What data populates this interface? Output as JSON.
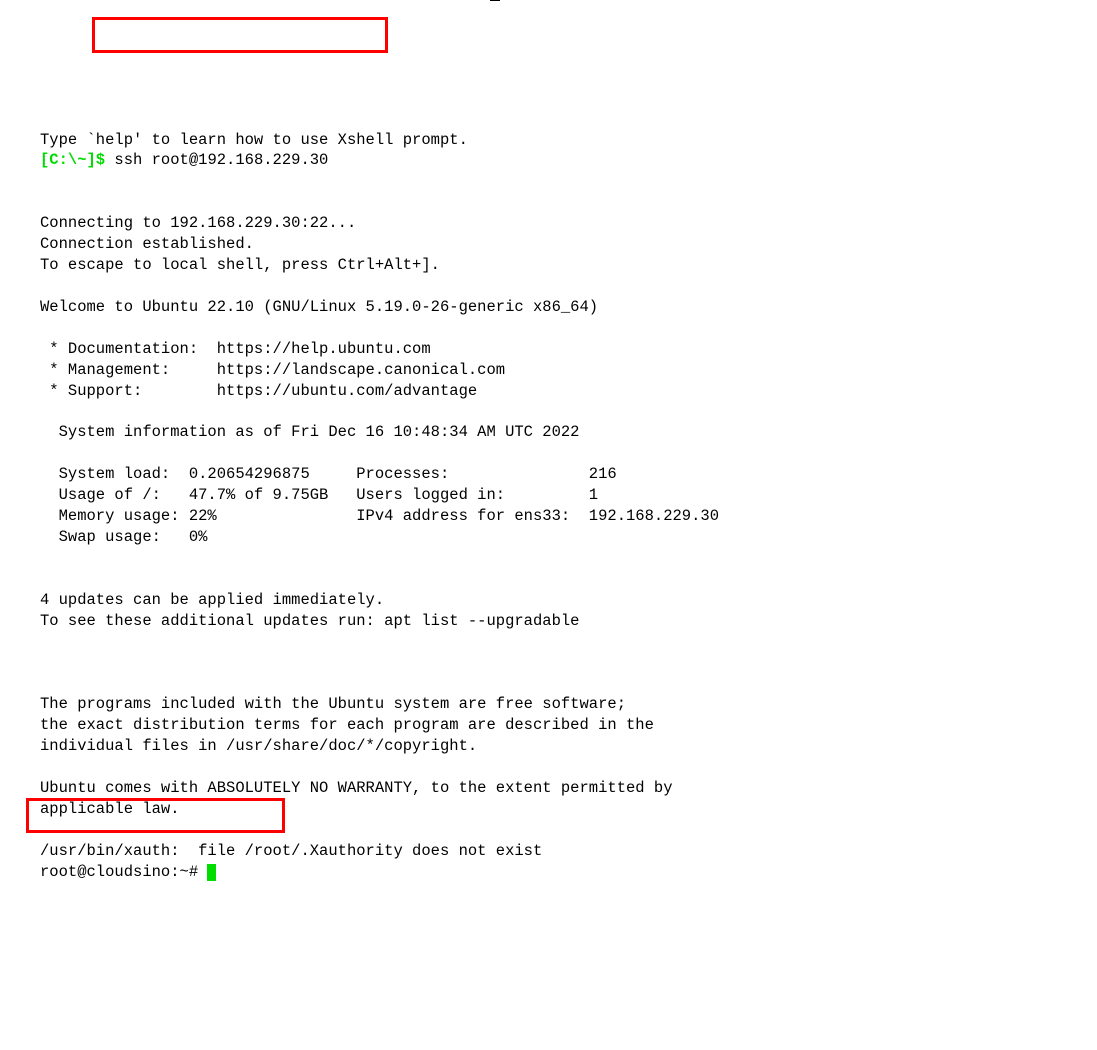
{
  "intro": "Type `help' to learn how to use Xshell prompt.",
  "prompt1_a": "[C:\\~]$",
  "prompt1_b": " ssh root@192.168.229.30",
  "connecting": "Connecting to 192.168.229.30:22...",
  "established": "Connection established.",
  "escape": "To escape to local shell, press Ctrl+Alt+].",
  "welcome": "Welcome to Ubuntu 22.10 (GNU/Linux 5.19.0-26-generic x86_64)",
  "doc": " * Documentation:  https://help.ubuntu.com",
  "mgmt": " * Management:     https://landscape.canonical.com",
  "support": " * Support:        https://ubuntu.com/advantage",
  "sysinfo_hdr": "  System information as of Fri Dec 16 10:48:34 AM UTC 2022",
  "row1": "  System load:  0.20654296875     Processes:               216",
  "row2": "  Usage of /:   47.7% of 9.75GB   Users logged in:         1",
  "row3": "  Memory usage: 22%               IPv4 address for ens33:  192.168.229.30",
  "row4": "  Swap usage:   0%",
  "updates1": "4 updates can be applied immediately.",
  "updates2": "To see these additional updates run: apt list --upgradable",
  "legal1": "The programs included with the Ubuntu system are free software;",
  "legal2": "the exact distribution terms for each program are described in the",
  "legal3": "individual files in /usr/share/doc/*/copyright.",
  "warranty1": "Ubuntu comes with ABSOLUTELY NO WARRANTY, to the extent permitted by",
  "warranty2": "applicable law.",
  "xauth": "/usr/bin/xauth:  file /root/.Xauthority does not exist",
  "prompt2": "root@cloudsino:~# "
}
